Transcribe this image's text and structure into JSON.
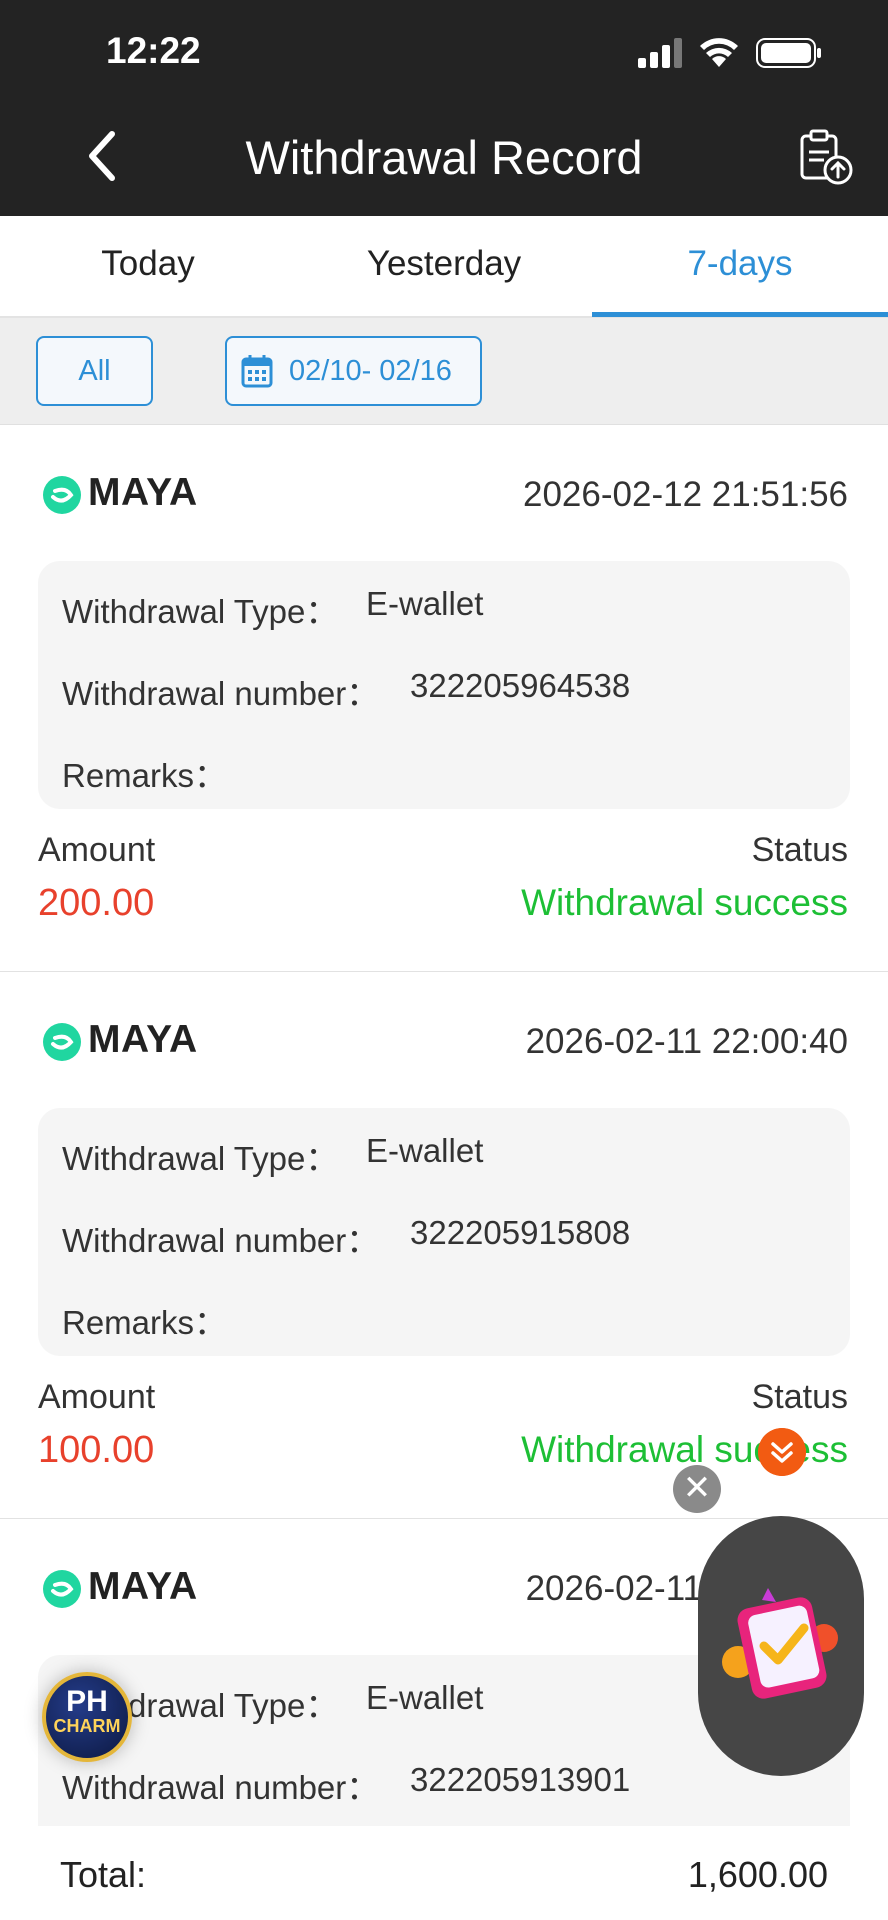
{
  "status_bar": {
    "time": "12:22"
  },
  "header": {
    "title": "Withdrawal Record"
  },
  "tabs": [
    {
      "label": "Today",
      "active": false
    },
    {
      "label": "Yesterday",
      "active": false
    },
    {
      "label": "7-days",
      "active": true
    }
  ],
  "filter": {
    "all_label": "All",
    "date_range": "02/10- 02/16"
  },
  "labels": {
    "withdrawal_type": "Withdrawal Type：",
    "withdrawal_number": "Withdrawal number：",
    "remarks": "Remarks：",
    "amount": "Amount",
    "status": "Status"
  },
  "records": [
    {
      "provider": "MAYA",
      "datetime": "2026-02-12 21:51:56",
      "type": "E-wallet",
      "number": "322205964538",
      "remarks": "",
      "amount": "200.00",
      "status": "Withdrawal success"
    },
    {
      "provider": "MAYA",
      "datetime": "2026-02-11 22:00:40",
      "type": "E-wallet",
      "number": "322205915808",
      "remarks": "",
      "amount": "100.00",
      "status": "Withdrawal success"
    },
    {
      "provider": "MAYA",
      "datetime": "2026-02-11 21:26:41",
      "type": "E-wallet",
      "number": "322205913901",
      "remarks": "",
      "amount": "",
      "status": ""
    }
  ],
  "total": {
    "label": "Total:",
    "value": "1,600.00"
  },
  "badge": {
    "line1": "PH",
    "line2": "CHARM"
  },
  "colors": {
    "accent": "#2d8fd6",
    "amount": "#e8412c",
    "success": "#1dbf35",
    "header_bg": "#232323"
  }
}
